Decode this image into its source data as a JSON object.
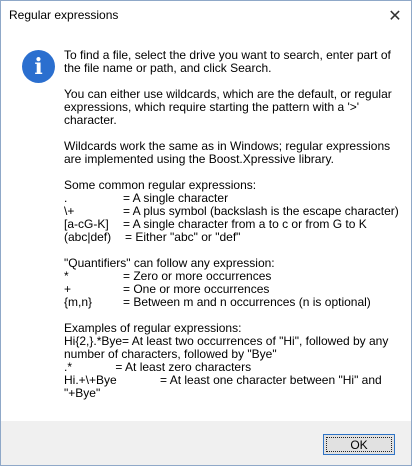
{
  "window": {
    "title": "Regular expressions",
    "close_glyph": "✕"
  },
  "icon": {
    "name": "info-icon",
    "glyph": "i",
    "color": "#2b6fcf"
  },
  "content": {
    "intro": "To find a file, select the drive you want to search, enter part of the file name or path, and click Search.",
    "wildcards_info": "You can either use wildcards, which are the default, or regular expressions, which require starting the pattern with a '>' character.",
    "wildcards_work": "Wildcards work the same as in Windows; regular expressions are implemented using the Boost.Xpressive library.",
    "common_heading": "Some common regular expressions:",
    "common": [
      {
        "key": ".",
        "desc": "= A single character"
      },
      {
        "key": "\\+",
        "desc": "= A plus symbol (backslash is the escape character)"
      },
      {
        "key": "[a-cG-K]",
        "desc": "= A single character from a to c or from G to K"
      },
      {
        "key": "(abc|def)",
        "desc": "= Either \"abc\" or \"def\""
      }
    ],
    "quantifiers_heading": "\"Quantifiers\" can follow any expression:",
    "quantifiers": [
      {
        "key": "*",
        "desc": "= Zero or more occurrences"
      },
      {
        "key": "+",
        "desc": "= One or more occurrences"
      },
      {
        "key": "{m,n}",
        "desc": "= Between m and n occurrences (n is optional)"
      }
    ],
    "examples_heading": "Examples of regular expressions:",
    "examples": [
      "Hi{2,}.*Bye= At least two occurrences of \"Hi\", followed by any number of characters, followed by \"Bye\"",
      ".*             = At least zero characters",
      "Hi.+\\+Bye             = At least one character between \"Hi\" and \"+Bye\""
    ]
  },
  "footer": {
    "ok_label": "OK"
  }
}
